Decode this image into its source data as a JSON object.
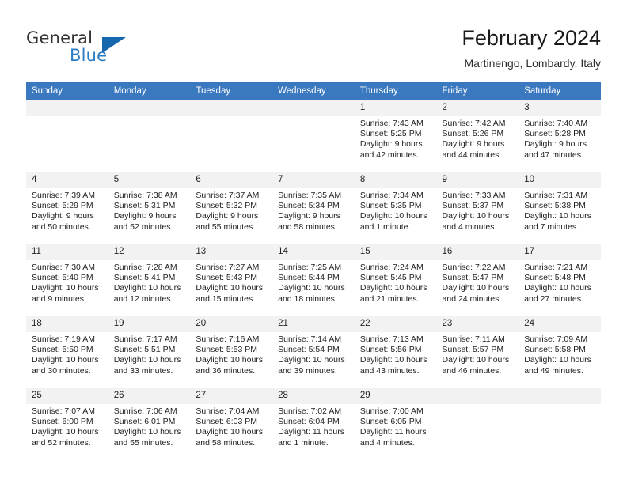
{
  "brand": {
    "line1": "General",
    "line2": "Blue",
    "triangle_color": "#1667ad",
    "blue_text_color": "#2b7cc4"
  },
  "header": {
    "title": "February 2024",
    "subtitle": "Martinengo, Lombardy, Italy"
  },
  "theme": {
    "header_blue": "#3a78bf",
    "daynum_band": "#f2f2f2",
    "text": "#1f1f1f"
  },
  "weekday_headers": [
    "Sunday",
    "Monday",
    "Tuesday",
    "Wednesday",
    "Thursday",
    "Friday",
    "Saturday"
  ],
  "weeks": [
    [
      {
        "day": "",
        "empty": true
      },
      {
        "day": "",
        "empty": true
      },
      {
        "day": "",
        "empty": true
      },
      {
        "day": "",
        "empty": true
      },
      {
        "day": "1",
        "sunrise": "Sunrise: 7:43 AM",
        "sunset": "Sunset: 5:25 PM",
        "daylight": "Daylight: 9 hours and 42 minutes."
      },
      {
        "day": "2",
        "sunrise": "Sunrise: 7:42 AM",
        "sunset": "Sunset: 5:26 PM",
        "daylight": "Daylight: 9 hours and 44 minutes."
      },
      {
        "day": "3",
        "sunrise": "Sunrise: 7:40 AM",
        "sunset": "Sunset: 5:28 PM",
        "daylight": "Daylight: 9 hours and 47 minutes."
      }
    ],
    [
      {
        "day": "4",
        "sunrise": "Sunrise: 7:39 AM",
        "sunset": "Sunset: 5:29 PM",
        "daylight": "Daylight: 9 hours and 50 minutes."
      },
      {
        "day": "5",
        "sunrise": "Sunrise: 7:38 AM",
        "sunset": "Sunset: 5:31 PM",
        "daylight": "Daylight: 9 hours and 52 minutes."
      },
      {
        "day": "6",
        "sunrise": "Sunrise: 7:37 AM",
        "sunset": "Sunset: 5:32 PM",
        "daylight": "Daylight: 9 hours and 55 minutes."
      },
      {
        "day": "7",
        "sunrise": "Sunrise: 7:35 AM",
        "sunset": "Sunset: 5:34 PM",
        "daylight": "Daylight: 9 hours and 58 minutes."
      },
      {
        "day": "8",
        "sunrise": "Sunrise: 7:34 AM",
        "sunset": "Sunset: 5:35 PM",
        "daylight": "Daylight: 10 hours and 1 minute."
      },
      {
        "day": "9",
        "sunrise": "Sunrise: 7:33 AM",
        "sunset": "Sunset: 5:37 PM",
        "daylight": "Daylight: 10 hours and 4 minutes."
      },
      {
        "day": "10",
        "sunrise": "Sunrise: 7:31 AM",
        "sunset": "Sunset: 5:38 PM",
        "daylight": "Daylight: 10 hours and 7 minutes."
      }
    ],
    [
      {
        "day": "11",
        "sunrise": "Sunrise: 7:30 AM",
        "sunset": "Sunset: 5:40 PM",
        "daylight": "Daylight: 10 hours and 9 minutes."
      },
      {
        "day": "12",
        "sunrise": "Sunrise: 7:28 AM",
        "sunset": "Sunset: 5:41 PM",
        "daylight": "Daylight: 10 hours and 12 minutes."
      },
      {
        "day": "13",
        "sunrise": "Sunrise: 7:27 AM",
        "sunset": "Sunset: 5:43 PM",
        "daylight": "Daylight: 10 hours and 15 minutes."
      },
      {
        "day": "14",
        "sunrise": "Sunrise: 7:25 AM",
        "sunset": "Sunset: 5:44 PM",
        "daylight": "Daylight: 10 hours and 18 minutes."
      },
      {
        "day": "15",
        "sunrise": "Sunrise: 7:24 AM",
        "sunset": "Sunset: 5:45 PM",
        "daylight": "Daylight: 10 hours and 21 minutes."
      },
      {
        "day": "16",
        "sunrise": "Sunrise: 7:22 AM",
        "sunset": "Sunset: 5:47 PM",
        "daylight": "Daylight: 10 hours and 24 minutes."
      },
      {
        "day": "17",
        "sunrise": "Sunrise: 7:21 AM",
        "sunset": "Sunset: 5:48 PM",
        "daylight": "Daylight: 10 hours and 27 minutes."
      }
    ],
    [
      {
        "day": "18",
        "sunrise": "Sunrise: 7:19 AM",
        "sunset": "Sunset: 5:50 PM",
        "daylight": "Daylight: 10 hours and 30 minutes."
      },
      {
        "day": "19",
        "sunrise": "Sunrise: 7:17 AM",
        "sunset": "Sunset: 5:51 PM",
        "daylight": "Daylight: 10 hours and 33 minutes."
      },
      {
        "day": "20",
        "sunrise": "Sunrise: 7:16 AM",
        "sunset": "Sunset: 5:53 PM",
        "daylight": "Daylight: 10 hours and 36 minutes."
      },
      {
        "day": "21",
        "sunrise": "Sunrise: 7:14 AM",
        "sunset": "Sunset: 5:54 PM",
        "daylight": "Daylight: 10 hours and 39 minutes."
      },
      {
        "day": "22",
        "sunrise": "Sunrise: 7:13 AM",
        "sunset": "Sunset: 5:56 PM",
        "daylight": "Daylight: 10 hours and 43 minutes."
      },
      {
        "day": "23",
        "sunrise": "Sunrise: 7:11 AM",
        "sunset": "Sunset: 5:57 PM",
        "daylight": "Daylight: 10 hours and 46 minutes."
      },
      {
        "day": "24",
        "sunrise": "Sunrise: 7:09 AM",
        "sunset": "Sunset: 5:58 PM",
        "daylight": "Daylight: 10 hours and 49 minutes."
      }
    ],
    [
      {
        "day": "25",
        "sunrise": "Sunrise: 7:07 AM",
        "sunset": "Sunset: 6:00 PM",
        "daylight": "Daylight: 10 hours and 52 minutes."
      },
      {
        "day": "26",
        "sunrise": "Sunrise: 7:06 AM",
        "sunset": "Sunset: 6:01 PM",
        "daylight": "Daylight: 10 hours and 55 minutes."
      },
      {
        "day": "27",
        "sunrise": "Sunrise: 7:04 AM",
        "sunset": "Sunset: 6:03 PM",
        "daylight": "Daylight: 10 hours and 58 minutes."
      },
      {
        "day": "28",
        "sunrise": "Sunrise: 7:02 AM",
        "sunset": "Sunset: 6:04 PM",
        "daylight": "Daylight: 11 hours and 1 minute."
      },
      {
        "day": "29",
        "sunrise": "Sunrise: 7:00 AM",
        "sunset": "Sunset: 6:05 PM",
        "daylight": "Daylight: 11 hours and 4 minutes."
      },
      {
        "day": "",
        "empty": true
      },
      {
        "day": "",
        "empty": true
      }
    ]
  ]
}
